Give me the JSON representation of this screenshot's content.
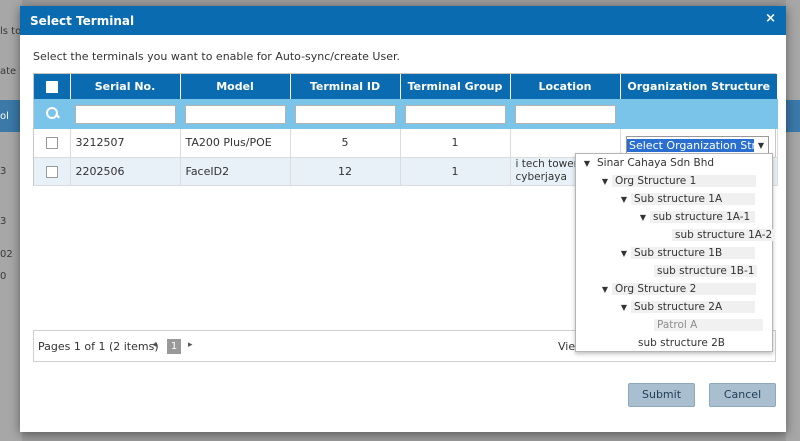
{
  "background": {
    "fragments": [
      "ls to",
      "ate fr",
      "ol",
      "3",
      "3",
      "02",
      "0"
    ]
  },
  "modal": {
    "title": "Select Terminal",
    "close": "×",
    "instruction": "Select the terminals you want to enable for Auto-sync/create User.",
    "columns": [
      "Serial No.",
      "Model",
      "Terminal ID",
      "Terminal Group",
      "Location",
      "Organization Structure"
    ],
    "rows": [
      {
        "serial": "3212507",
        "model": "TA200 Plus/POE",
        "terminal_id": "5",
        "group": "1",
        "location": "",
        "org": ""
      },
      {
        "serial": "2202506",
        "model": "FaceID2",
        "terminal_id": "12",
        "group": "1",
        "location": "i tech tower, cyberjaya",
        "org": ""
      }
    ],
    "select": {
      "value": "Select Organization Structure"
    },
    "tree": [
      {
        "label": "Sinar Cahaya Sdn Bhd",
        "level": 0,
        "expanded": true
      },
      {
        "label": "Org Structure 1",
        "level": 1,
        "expanded": true
      },
      {
        "label": "Sub structure 1A",
        "level": 2,
        "expanded": true
      },
      {
        "label": "sub structure 1A-1",
        "level": 3,
        "expanded": true
      },
      {
        "label": "sub structure 1A-2",
        "level": 4
      },
      {
        "label": "Sub structure 1B",
        "level": 2,
        "expanded": true
      },
      {
        "label": "sub structure 1B-1",
        "level": 3
      },
      {
        "label": "Org Structure 2",
        "level": 1,
        "expanded": true
      },
      {
        "label": "Sub structure 2A",
        "level": 2,
        "expanded": true
      },
      {
        "label": "Patrol A",
        "level": 3,
        "muted": true
      },
      {
        "label": "sub structure 2B",
        "level": 2
      }
    ],
    "pager": {
      "text": "Pages 1 of 1 (2 items)",
      "prev": "◂",
      "page": "1",
      "next": "▸",
      "view": "Vie"
    },
    "buttons": {
      "submit": "Submit",
      "cancel": "Cancel"
    }
  }
}
